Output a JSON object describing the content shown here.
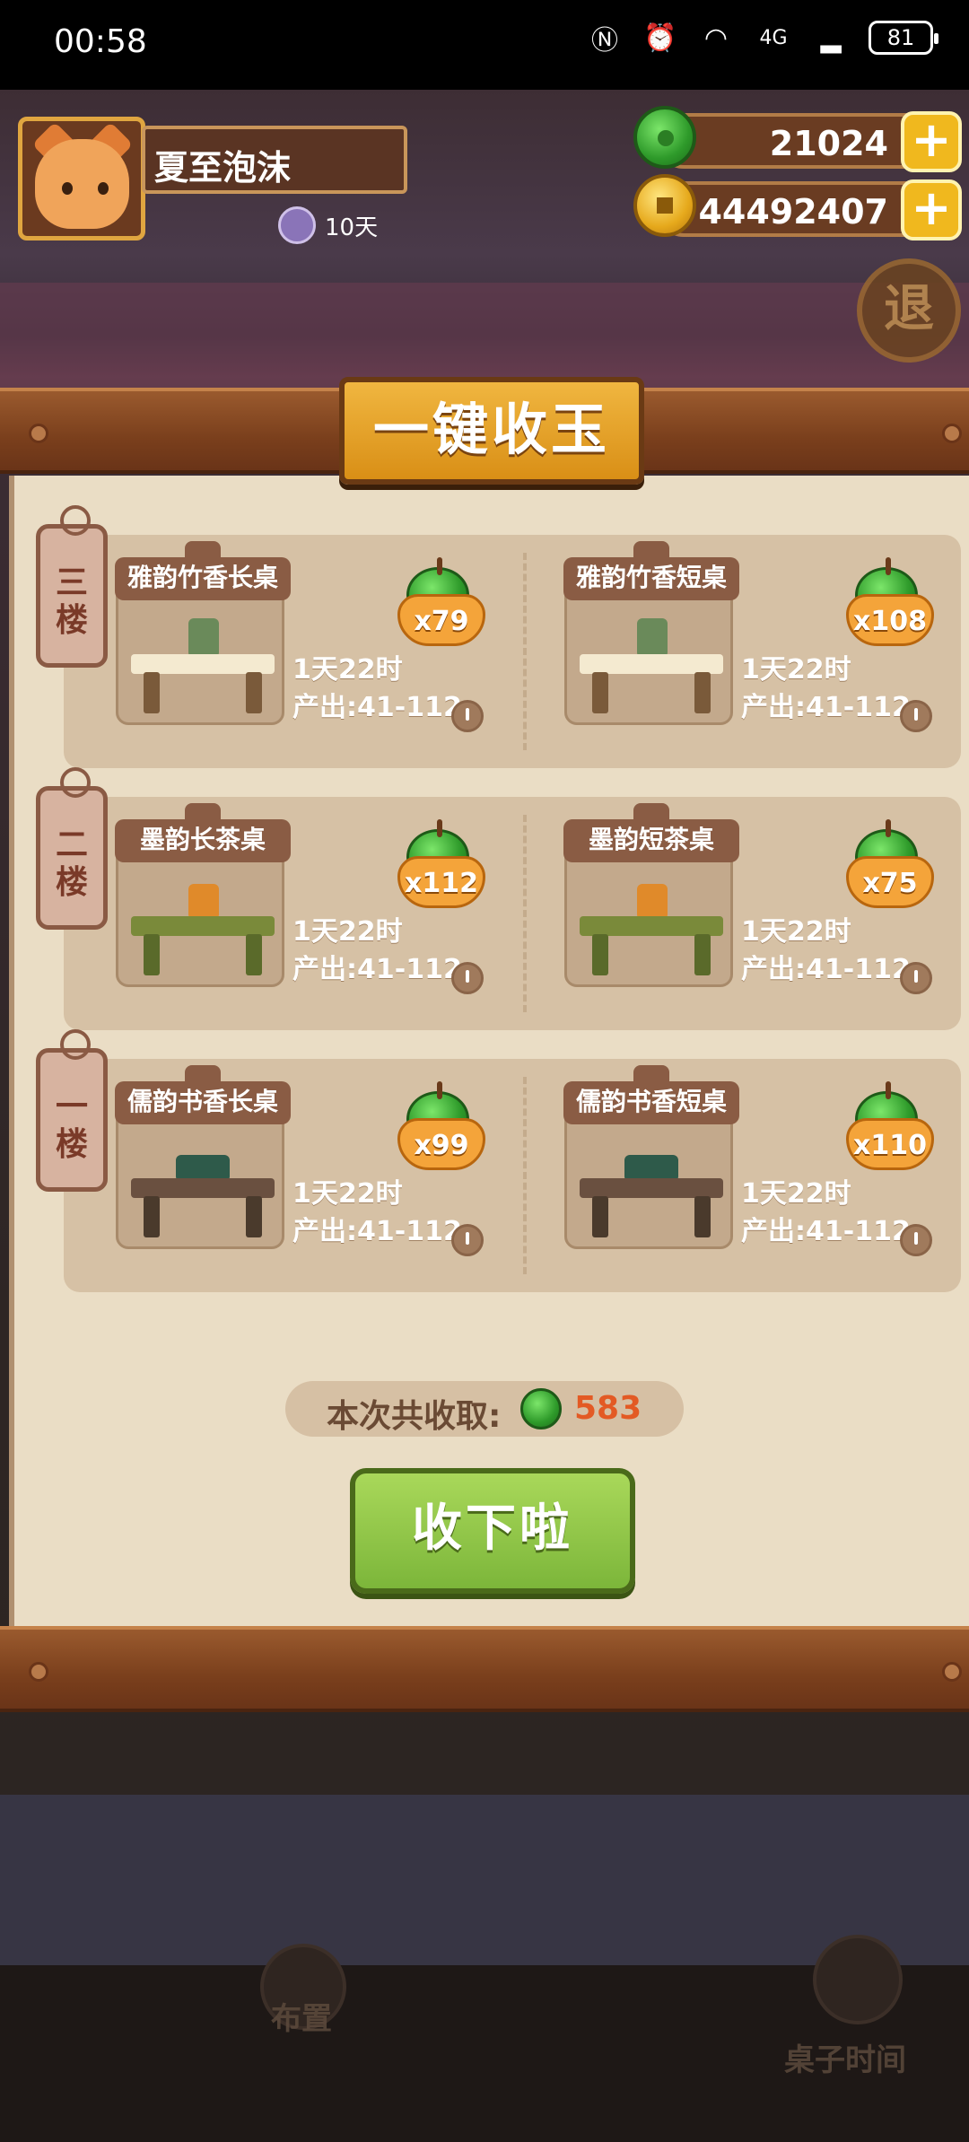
{
  "status_bar": {
    "time": "00:58",
    "signal_label": "4G",
    "battery": "81"
  },
  "header": {
    "player_name": "夏至泡沫",
    "days": "10天"
  },
  "resources": {
    "jade": "21024",
    "coins": "44492407"
  },
  "exit_label": "退",
  "panel": {
    "title": "一键收玉",
    "floors": [
      {
        "label": "三楼",
        "tables": [
          {
            "name": "雅韵竹香长桌",
            "reward": "x79",
            "time": "1天22时",
            "output": "产出:41-112"
          },
          {
            "name": "雅韵竹香短桌",
            "reward": "x108",
            "time": "1天22时",
            "output": "产出:41-112"
          }
        ]
      },
      {
        "label": "二楼",
        "tables": [
          {
            "name": "墨韵长茶桌",
            "reward": "x112",
            "time": "1天22时",
            "output": "产出:41-112"
          },
          {
            "name": "墨韵短茶桌",
            "reward": "x75",
            "time": "1天22时",
            "output": "产出:41-112"
          }
        ]
      },
      {
        "label": "一楼",
        "tables": [
          {
            "name": "儒韵书香长桌",
            "reward": "x99",
            "time": "1天22时",
            "output": "产出:41-112"
          },
          {
            "name": "儒韵书香短桌",
            "reward": "x110",
            "time": "1天22时",
            "output": "产出:41-112"
          }
        ]
      }
    ],
    "total_label": "本次共收取:",
    "total_value": "583",
    "collect_button": "收下啦"
  },
  "background_buttons": {
    "layout": "布置",
    "table_time": "桌子时间"
  },
  "colors": {
    "jade": "#2e9a2a",
    "gold": "#e6a91c",
    "accent_red": "#e35a24",
    "button_green": "#7cb63a"
  }
}
